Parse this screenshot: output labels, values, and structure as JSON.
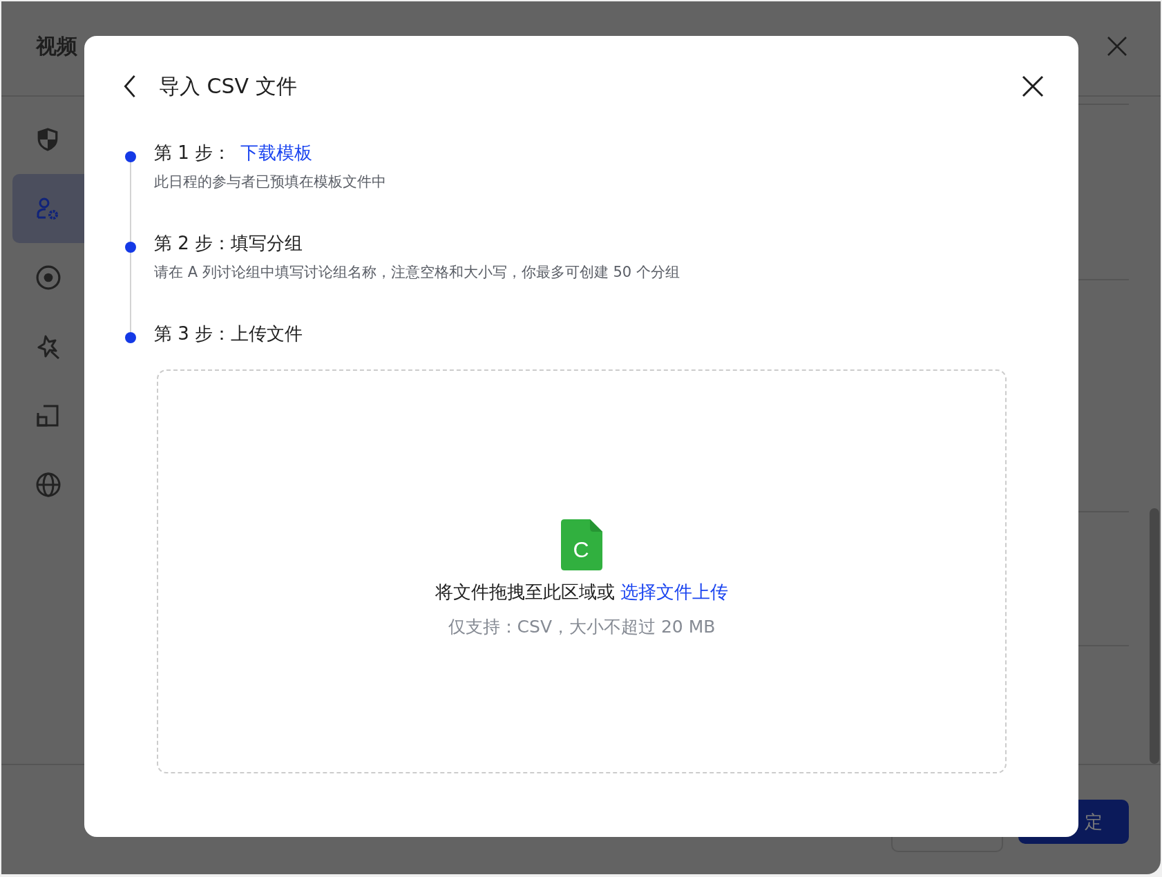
{
  "background_window": {
    "title": "视频",
    "sidebar": {
      "items": [
        {
          "kind": "shield",
          "selected": false
        },
        {
          "kind": "people-gear",
          "selected": true
        },
        {
          "kind": "record",
          "selected": false
        },
        {
          "kind": "sparkle",
          "selected": false
        },
        {
          "kind": "frame",
          "selected": false
        },
        {
          "kind": "globe",
          "selected": false
        }
      ]
    },
    "confirm_button": "定"
  },
  "dialog": {
    "title": "导入 CSV 文件",
    "steps": [
      {
        "label": "第 1 步：",
        "link": "下载模板",
        "description": "此日程的参与者已预填在模板文件中"
      },
      {
        "label": "第 2 步：填写分组",
        "description": "请在 A 列讨论组中填写讨论组名称，注意空格和大小写，你最多可创建 50 个分组"
      },
      {
        "label": "第 3 步：上传文件"
      }
    ],
    "dropzone": {
      "file_letter": "C",
      "prompt": "将文件拖拽至此区域或",
      "link": "选择文件上传",
      "hint": "仅支持：CSV，大小不超过 20 MB"
    }
  }
}
